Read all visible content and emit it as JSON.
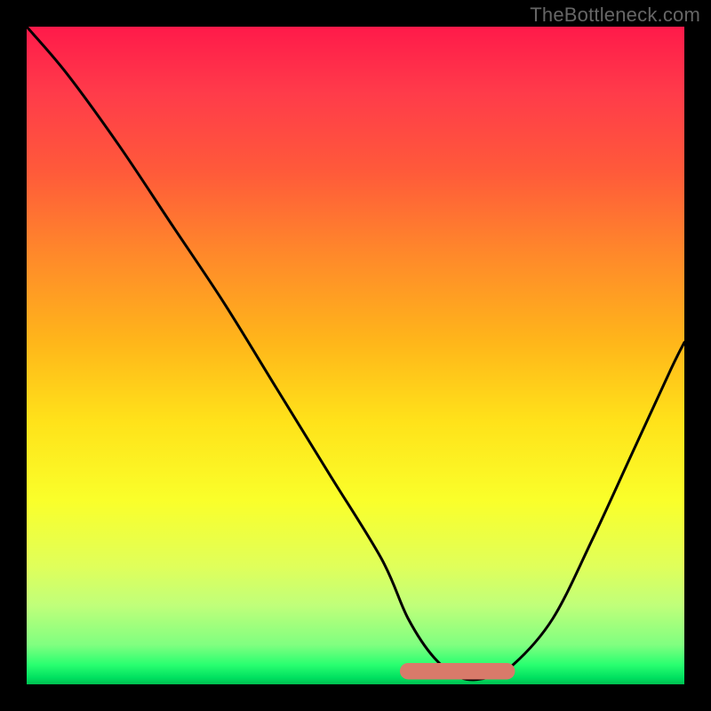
{
  "watermark": "TheBottleneck.com",
  "chart_data": {
    "type": "line",
    "title": "",
    "xlabel": "",
    "ylabel": "",
    "xlim": [
      0,
      100
    ],
    "ylim": [
      0,
      100
    ],
    "background_gradient": {
      "direction": "top-to-bottom",
      "stops": [
        {
          "pos": 0,
          "color": "#ff1a4a"
        },
        {
          "pos": 10,
          "color": "#ff3b4a"
        },
        {
          "pos": 22,
          "color": "#ff5a3a"
        },
        {
          "pos": 35,
          "color": "#ff8a2a"
        },
        {
          "pos": 48,
          "color": "#ffb61a"
        },
        {
          "pos": 60,
          "color": "#ffe21a"
        },
        {
          "pos": 72,
          "color": "#faff2a"
        },
        {
          "pos": 82,
          "color": "#e0ff5a"
        },
        {
          "pos": 88,
          "color": "#c0ff7a"
        },
        {
          "pos": 94,
          "color": "#80ff80"
        },
        {
          "pos": 97,
          "color": "#2aff70"
        },
        {
          "pos": 99,
          "color": "#00e060"
        },
        {
          "pos": 100,
          "color": "#00c050"
        }
      ]
    },
    "series": [
      {
        "name": "bottleneck-curve",
        "color": "#000000",
        "x": [
          0,
          6,
          14,
          22,
          30,
          38,
          46,
          54,
          58,
          62,
          66,
          70,
          74,
          80,
          86,
          92,
          98,
          100
        ],
        "values": [
          100,
          93,
          82,
          70,
          58,
          45,
          32,
          19,
          10,
          4,
          1,
          1,
          3,
          10,
          22,
          35,
          48,
          52
        ]
      }
    ],
    "annotations": [
      {
        "name": "optimal-zone-marker",
        "shape": "rounded-segment",
        "color": "#d97a6a",
        "x_range": [
          58,
          73
        ],
        "y": 2,
        "thickness": 2.5
      }
    ]
  }
}
